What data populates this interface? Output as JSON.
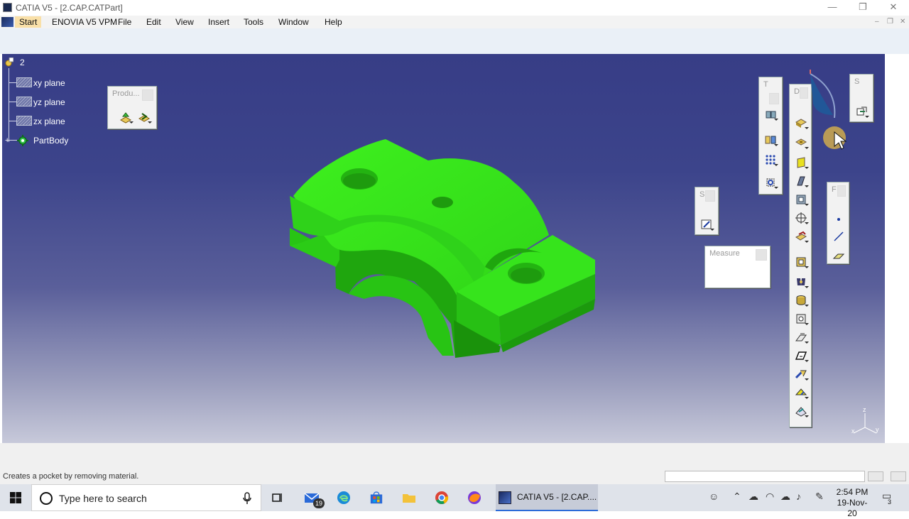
{
  "window": {
    "title": "CATIA V5 - [2.CAP.CATPart]"
  },
  "menu": {
    "items": [
      "Start",
      "ENOVIA V5 VPM",
      "File",
      "Edit",
      "View",
      "Insert",
      "Tools",
      "Window",
      "Help"
    ]
  },
  "tree": {
    "root": "2",
    "nodes": [
      "xy plane",
      "yz plane",
      "zx plane",
      "PartBody"
    ]
  },
  "toolbars": {
    "product": {
      "caption": "Produ..."
    },
    "t": {
      "caption": "T"
    },
    "d": {
      "caption": "D"
    },
    "s_top": {
      "caption": "S"
    },
    "s_mid": {
      "caption": "S"
    },
    "f": {
      "caption": "F"
    },
    "measure": {
      "caption": "Measure"
    }
  },
  "compass": {
    "axis_z": "z",
    "axis_x": "x",
    "axis_y": "y"
  },
  "status": {
    "message": "Creates a pocket by removing material."
  },
  "taskbar": {
    "search_placeholder": "Type here to search",
    "mail_badge": "19",
    "active_task": "CATIA V5 - [2.CAP....",
    "time": "2:54 PM",
    "date": "19-Nov-20",
    "notification_count": "3"
  },
  "colors": {
    "part": "#33e01a",
    "viewport_top": "#373d86",
    "viewport_bottom": "#c7c9da"
  }
}
